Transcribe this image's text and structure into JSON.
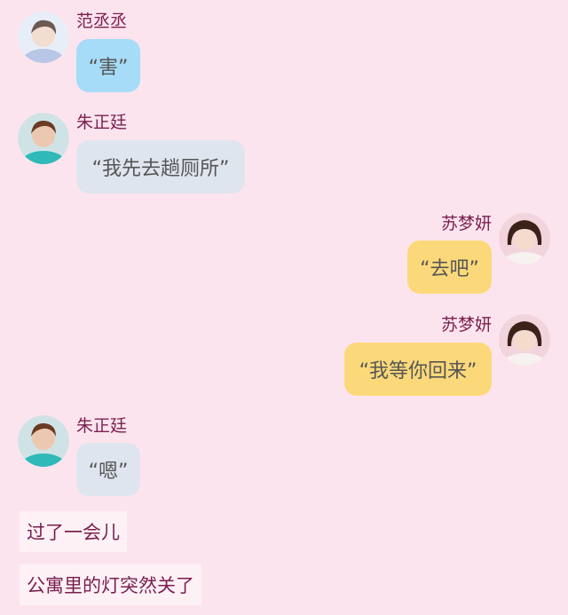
{
  "messages": [
    {
      "sender": "范丞丞",
      "text": "“害”"
    },
    {
      "sender": "朱正廷",
      "text": "“我先去趟厕所”"
    },
    {
      "sender": "苏梦妍",
      "text": "“去吧”"
    },
    {
      "sender": "苏梦妍",
      "text": "“我等你回来”"
    },
    {
      "sender": "朱正廷",
      "text": "“嗯”"
    }
  ],
  "narration": [
    "过了一会儿",
    "公寓里的灯突然关了"
  ],
  "colors": {
    "background": "#fce4ee",
    "name_text": "#7a1f4e",
    "bubble_blue": "#a6dcf8",
    "bubble_gray": "#dfe5ee",
    "bubble_yellow": "#fbd97a",
    "narration_bg": "#fdf1f6"
  }
}
